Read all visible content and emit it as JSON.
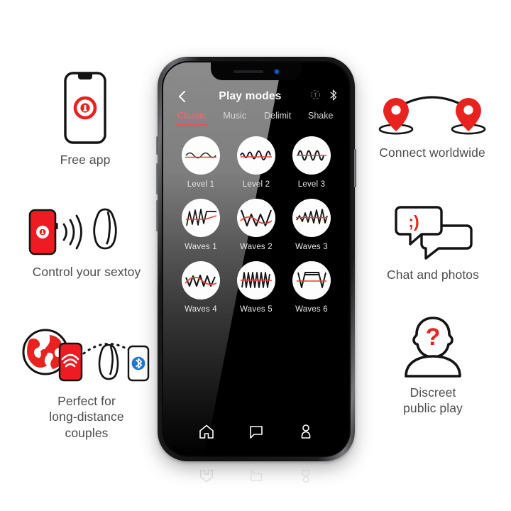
{
  "features": {
    "free_app": {
      "caption": "Free app",
      "icon": "phone-with-app-logo-icon"
    },
    "control": {
      "caption": "Control your sextoy",
      "icon": "phone-connects-to-toy-icon"
    },
    "long_distance": {
      "caption": "Perfect for\nlong-distance\ncouples",
      "icon": "globe-phone-toy-bluetooth-icon"
    },
    "connect": {
      "caption": "Connect worldwide",
      "icon": "two-map-pins-arc-icon"
    },
    "chat": {
      "caption": "Chat and photos",
      "icon": "speech-bubbles-emoticon-icon",
      "emoticon": ";)"
    },
    "discreet": {
      "caption": "Discreet\npublic play",
      "icon": "person-question-mark-icon",
      "question": "?"
    }
  },
  "phone": {
    "appbar": {
      "back_icon": "chevron-left-icon",
      "title": "Play modes",
      "right_icons": [
        "target-icon",
        "bluetooth-icon"
      ]
    },
    "tabs": [
      {
        "label": "Classic",
        "active": true
      },
      {
        "label": "Music",
        "active": false
      },
      {
        "label": "Delimit",
        "active": false
      },
      {
        "label": "Shake",
        "active": false
      }
    ],
    "modes": [
      {
        "label": "Level 1",
        "pattern": "sine-low-amplitude"
      },
      {
        "label": "Level 2",
        "pattern": "sine-medium-amplitude"
      },
      {
        "label": "Level 3",
        "pattern": "sine-high-amplitude"
      },
      {
        "label": "Waves 1",
        "pattern": "ramp-then-plateau"
      },
      {
        "label": "Waves 2",
        "pattern": "zigzag-wide-peaks"
      },
      {
        "label": "Waves 3",
        "pattern": "ascending-zigzag"
      },
      {
        "label": "Waves 4",
        "pattern": "rounded-zigzag"
      },
      {
        "label": "Waves 5",
        "pattern": "dense-triangle-wave"
      },
      {
        "label": "Waves 6",
        "pattern": "trapezoid-step"
      }
    ],
    "navbar": [
      {
        "icon": "home-icon",
        "name": "home"
      },
      {
        "icon": "chat-icon",
        "name": "chat"
      },
      {
        "icon": "profile-icon",
        "name": "profile"
      }
    ]
  },
  "colors": {
    "brand_red": "#e8231f",
    "accent_red": "#e8534f",
    "tab_active": "#ef6d6d",
    "caption_gray": "#4c4c4c",
    "bluetooth_blue": "#1e78d7",
    "screen_black": "#000000"
  }
}
